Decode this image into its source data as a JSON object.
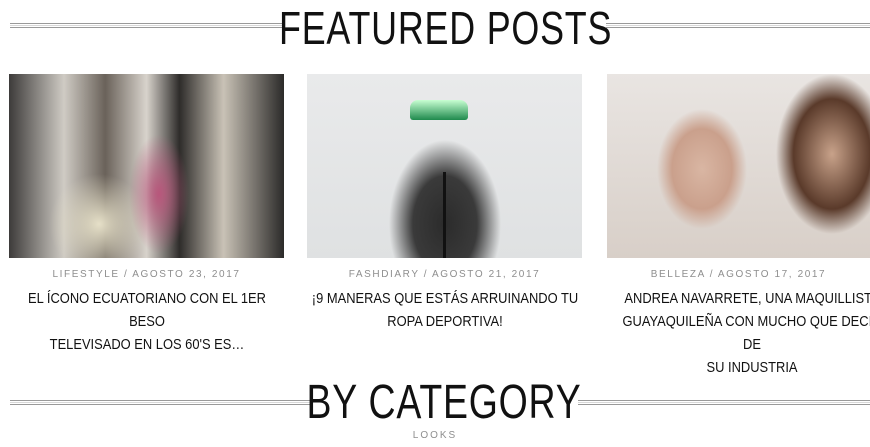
{
  "featured": {
    "heading": "FEATURED POSTS",
    "posts": [
      {
        "category": "LIFESTYLE",
        "date": "AGOSTO 23, 2017",
        "meta": "LIFESTYLE / AGOSTO 23, 2017",
        "title_line1": "EL ÍCONO ECUATORIANO CON EL 1ER BESO",
        "title_line2": "TELEVISADO EN LOS 60'S ES…",
        "title_line3": ""
      },
      {
        "category": "FASHDIARY",
        "date": "AGOSTO 21, 2017",
        "meta": "FASHDIARY / AGOSTO 21, 2017",
        "title_line1": "¡9 MANERAS QUE ESTÁS ARRUINANDO TU",
        "title_line2": "ROPA DEPORTIVA!",
        "title_line3": ""
      },
      {
        "category": "BELLEZA",
        "date": "AGOSTO 17, 2017",
        "meta": "BELLEZA / AGOSTO 17, 2017",
        "title_line1": "ANDREA NAVARRETE, UNA MAQUILLISTA",
        "title_line2": "GUAYAQUILEÑA CON MUCHO QUE DECIR DE",
        "title_line3": "SU INDUSTRIA"
      }
    ]
  },
  "by_category": {
    "heading": "BY CATEGORY",
    "first_category": "LOOKS"
  }
}
